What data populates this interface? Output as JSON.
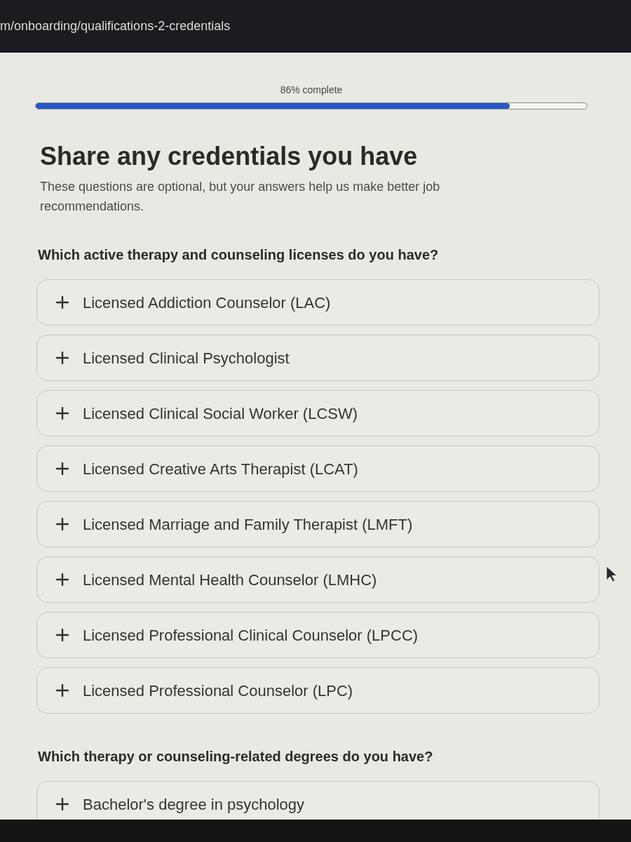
{
  "address_bar": {
    "url": "m/onboarding/qualifications-2-credentials"
  },
  "progress": {
    "label": "86% complete",
    "level": 0.86
  },
  "header": {
    "title": "Share any credentials you have",
    "subtitle": "These questions are optional, but your answers help us make better job recommendations."
  },
  "sections": [
    {
      "question": "Which active therapy and counseling licenses do you have?",
      "options": [
        {
          "label": "Licensed Addiction Counselor (LAC)",
          "selected": false
        },
        {
          "label": "Licensed Clinical Psychologist",
          "selected": false
        },
        {
          "label": "Licensed Clinical Social Worker (LCSW)",
          "selected": false
        },
        {
          "label": "Licensed Creative Arts Therapist (LCAT)",
          "selected": false
        },
        {
          "label": "Licensed Marriage and Family Therapist (LMFT)",
          "selected": false
        },
        {
          "label": "Licensed Mental Health Counselor (LMHC)",
          "selected": false
        },
        {
          "label": "Licensed Professional Clinical Counselor (LPCC)",
          "selected": false
        },
        {
          "label": "Licensed Professional Counselor (LPC)",
          "selected": false
        }
      ]
    },
    {
      "question": "Which therapy or counseling-related degrees do you have?",
      "options": [
        {
          "label": "Bachelor's degree in psychology",
          "selected": false
        }
      ]
    }
  ]
}
